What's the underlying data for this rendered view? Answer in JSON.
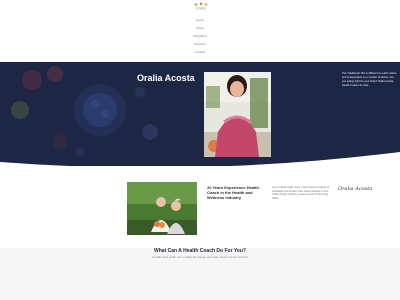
{
  "header": {
    "topbar_text": "",
    "logo_text": "Oralia",
    "nav": [
      "Home",
      "About",
      "Programs",
      "Services",
      "Contact"
    ]
  },
  "hero": {
    "title": "Oralia Acosta",
    "text": "The \"traditional\" diet is different for each culture and is dependent on a number of factors. Are you eating right for your body? Oralia Acosta, Health Coach can help."
  },
  "intro": {
    "heading": "20 Years Experience Health Coach in the Health and Wellness Industry",
    "body": "As a certified health coach, I have helped hundreds of individuals and families make lasting changes to their health through nutrition, movement and mindful living habits.",
    "signature": "Oralia Acosta"
  },
  "services": {
    "title": "What Can A Health Coach Do For You?",
    "subtitle": "A health coach guides you in making the changes your body needs to feel its very best."
  },
  "colors": {
    "hero_bg": "#1d2745",
    "accent": "#e0784a",
    "page_bg": "#ffffff"
  }
}
